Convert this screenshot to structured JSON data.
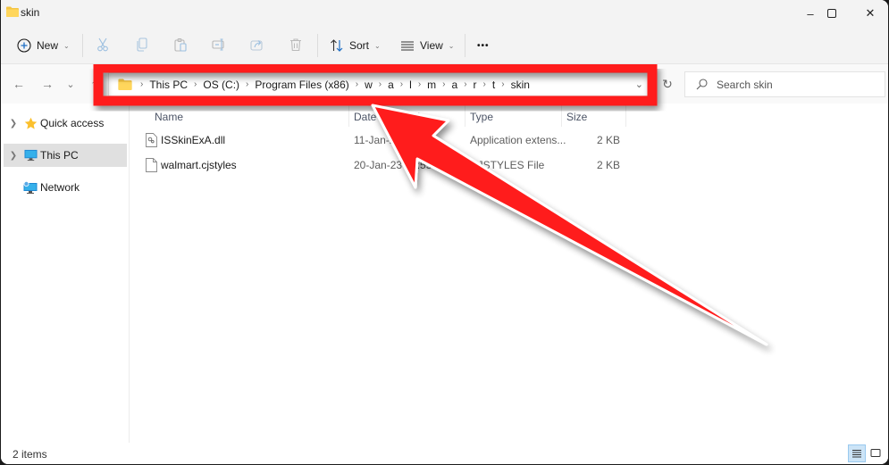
{
  "window": {
    "title": "skin",
    "minimize_glyph": "–",
    "maximize_glyph": "☐",
    "close_glyph": "✕"
  },
  "toolbar": {
    "new_label": "New",
    "sort_label": "Sort",
    "view_label": "View",
    "more_label": "•••",
    "icons": [
      "plus-circle-icon",
      "cut-icon",
      "copy-icon",
      "paste-icon",
      "rename-icon",
      "share-icon",
      "delete-icon",
      "sort-icon",
      "view-icon",
      "more-icon"
    ]
  },
  "navigation": {
    "back": "←",
    "forward": "→",
    "recent": "⌄",
    "up": "↑"
  },
  "address_bar": {
    "crumbs": [
      "This PC",
      "OS (C:)",
      "Program Files (x86)",
      "w",
      "a",
      "l",
      "m",
      "a",
      "r",
      "t",
      "skin"
    ],
    "separator": "›"
  },
  "search": {
    "placeholder": "Search skin"
  },
  "sidebar": {
    "items": [
      {
        "label": "Quick access",
        "icon": "star-icon",
        "expandable": true,
        "selected": false
      },
      {
        "label": "This PC",
        "icon": "monitor-icon",
        "expandable": true,
        "selected": true
      },
      {
        "label": "Network",
        "icon": "network-icon",
        "expandable": false,
        "selected": false
      }
    ]
  },
  "file_list": {
    "columns": [
      "Name",
      "Date modified",
      "Type",
      "Size"
    ],
    "rows": [
      {
        "name": "ISSkinExA.dll",
        "date": "11-Jan-23 06:44",
        "type": "Application extens...",
        "size": "2 KB",
        "icon": "dll-file-icon"
      },
      {
        "name": "walmart.cjstyles",
        "date": "20-Jan-23 14:55",
        "type": "CJSTYLES File",
        "size": "2 KB",
        "icon": "generic-file-icon"
      }
    ]
  },
  "status_bar": {
    "item_count": "2 items"
  },
  "annotation": {
    "color": "#ff1e1e",
    "type": "highlight-box-with-arrow",
    "target": "address-bar"
  }
}
